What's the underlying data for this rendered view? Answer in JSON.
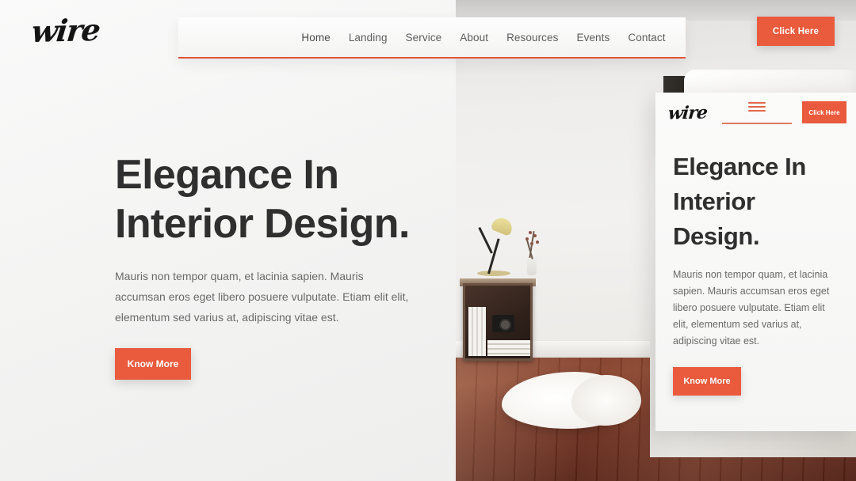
{
  "theme": {
    "accent": "#ea5a3d",
    "accent_line": "#e2553a",
    "heading_color": "#2f2f2f",
    "body_text_color": "#6a6a6a",
    "page_background": "#f0f0ef"
  },
  "brand": {
    "logo_text": "wire"
  },
  "navbar": {
    "items": [
      {
        "label": "Home"
      },
      {
        "label": "Landing"
      },
      {
        "label": "Service"
      },
      {
        "label": "About"
      },
      {
        "label": "Resources"
      },
      {
        "label": "Events"
      },
      {
        "label": "Contact"
      }
    ]
  },
  "header": {
    "cta_label": "Click Here"
  },
  "hero": {
    "heading": "Elegance In Interior Design.",
    "paragraph": "Mauris non tempor quam, et lacinia sapien. Mauris accumsan eros eget libero posuere vulputate. Etiam elit elit, elementum sed varius at, adipiscing vitae est.",
    "button_label": "Know More"
  },
  "mobile_card": {
    "logo_text": "wire",
    "menu_icon": "hamburger-menu-icon",
    "cta_label": "Click Here",
    "heading": "Elegance In Interior Design.",
    "paragraph": "Mauris non tempor quam, et lacinia sapien. Mauris accumsan eros eget libero posuere vulputate. Etiam elit elit, elementum sed varius at, adipiscing vitae est.",
    "button_label": "Know More"
  },
  "photo": {
    "alt": "bedroom-interior-photo",
    "description": "Bedroom interior with white bedding, dark wooden crate nightstand, desk lamp, dried flowers in vase, sheepskin rug and dark hardwood floor"
  }
}
